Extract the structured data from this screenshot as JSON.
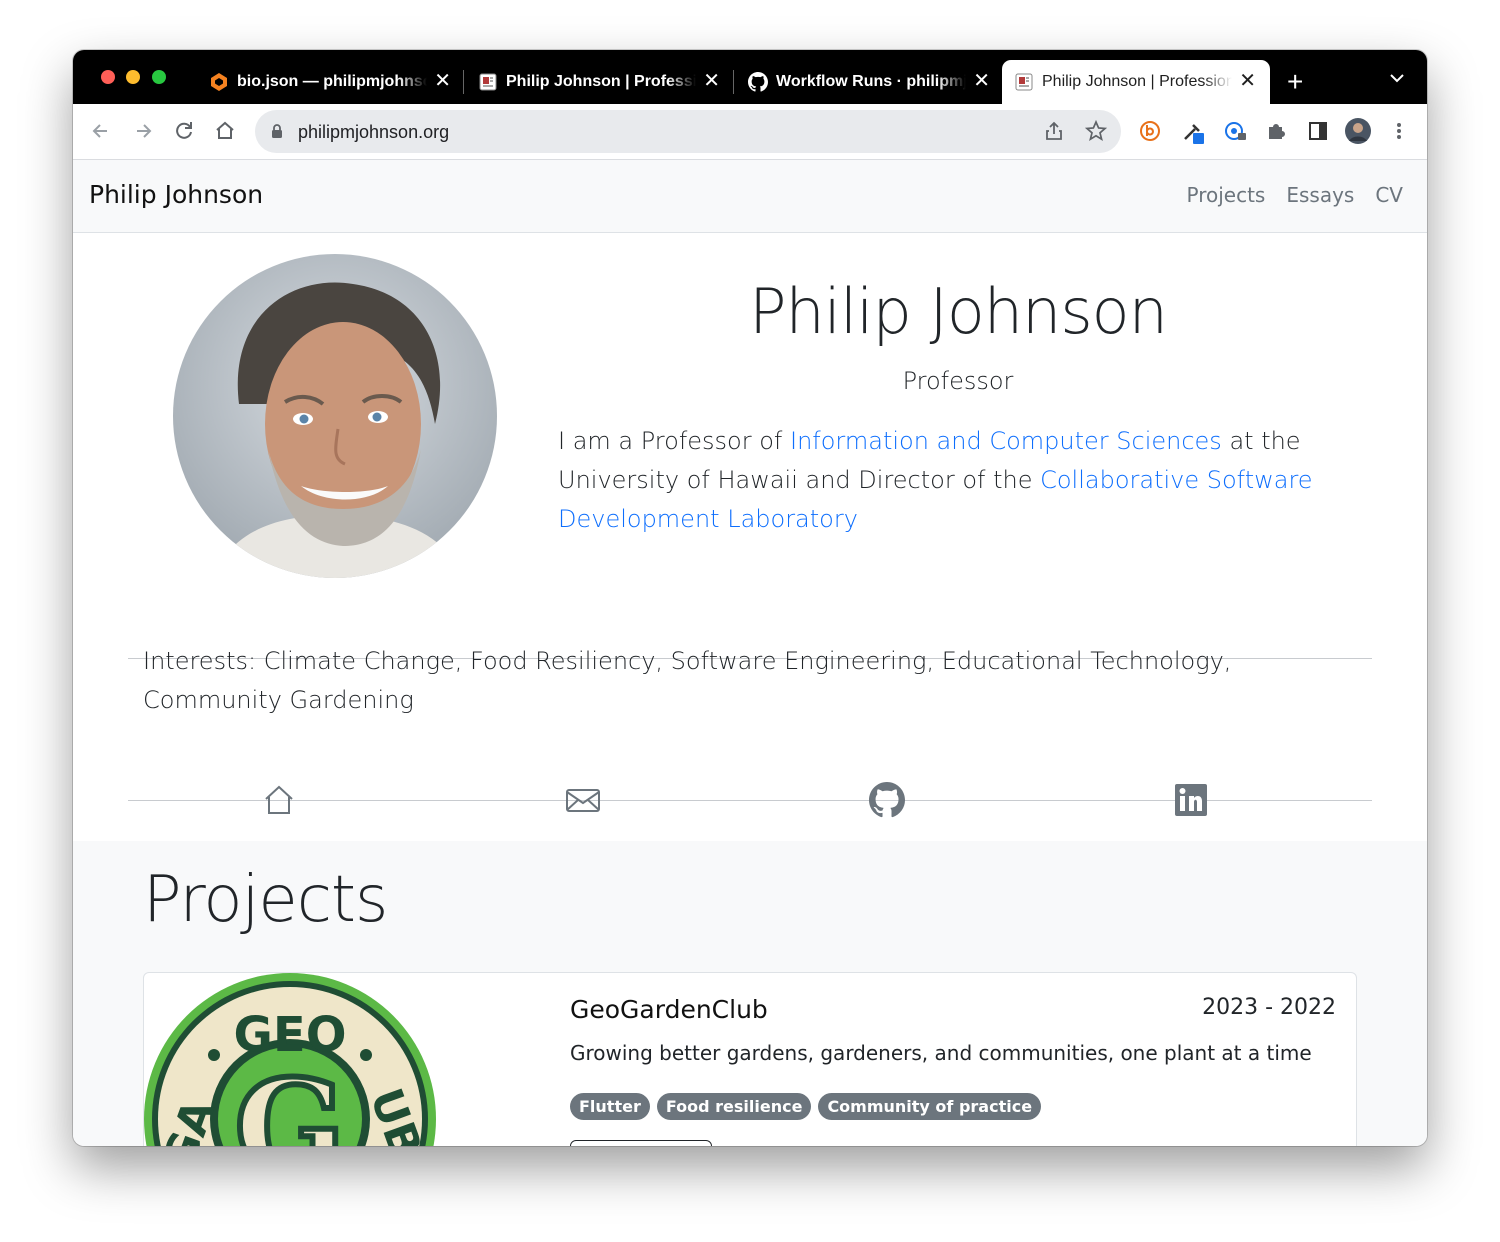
{
  "browser": {
    "tabs": [
      {
        "title": "bio.json — philipmjohnson",
        "active": false,
        "favicon": "jetbrains-logo-icon"
      },
      {
        "title": "Philip Johnson | Professional Portfolio",
        "active": false,
        "favicon": "portfolio-favicon"
      },
      {
        "title": "Workflow Runs · philipmjohnson",
        "active": false,
        "favicon": "github-icon"
      },
      {
        "title": "Philip Johnson | Professional Portfolio",
        "active": true,
        "favicon": "portfolio-favicon"
      }
    ],
    "tab_close_glyph": "✕",
    "new_tab_glyph": "+",
    "url": "philipmjohnson.org"
  },
  "navbar": {
    "brand": "Philip Johnson",
    "links": [
      "Projects",
      "Essays",
      "CV"
    ]
  },
  "hero": {
    "name": "Philip Johnson",
    "title": "Professor",
    "bio_parts": {
      "p1": "I am a Professor of ",
      "link1": "Information and Computer Sciences",
      "p2": " at the University of Hawaii and Director of the ",
      "link2": "Collaborative Software Development Laboratory"
    },
    "link_color": "#0d6efd"
  },
  "interests": "Interests: Climate Change, Food Resiliency, Software Engineering, Educational Technology, Community Gardening",
  "social_icons": [
    "home-icon",
    "email-icon",
    "github-icon",
    "linkedin-icon"
  ],
  "projects": {
    "heading": "Projects",
    "items": [
      {
        "name": "GeoGardenClub",
        "dates": "2023 - 2022",
        "description": "Growing better gardens, gardeners, and communities, one plant at a time",
        "tags": [
          "Flutter",
          "Food resilience",
          "Community of practice"
        ],
        "logo_text_top": "GEO",
        "logo_text_left": "GA",
        "logo_text_right": "UB",
        "logo_letter": "G"
      }
    ]
  },
  "colors": {
    "navbar_bg": "#f8f9fa",
    "badge_bg": "#6c757d",
    "logo_green": "#5cb946",
    "logo_dark": "#1f4d34",
    "logo_cream": "#efe6c9"
  }
}
